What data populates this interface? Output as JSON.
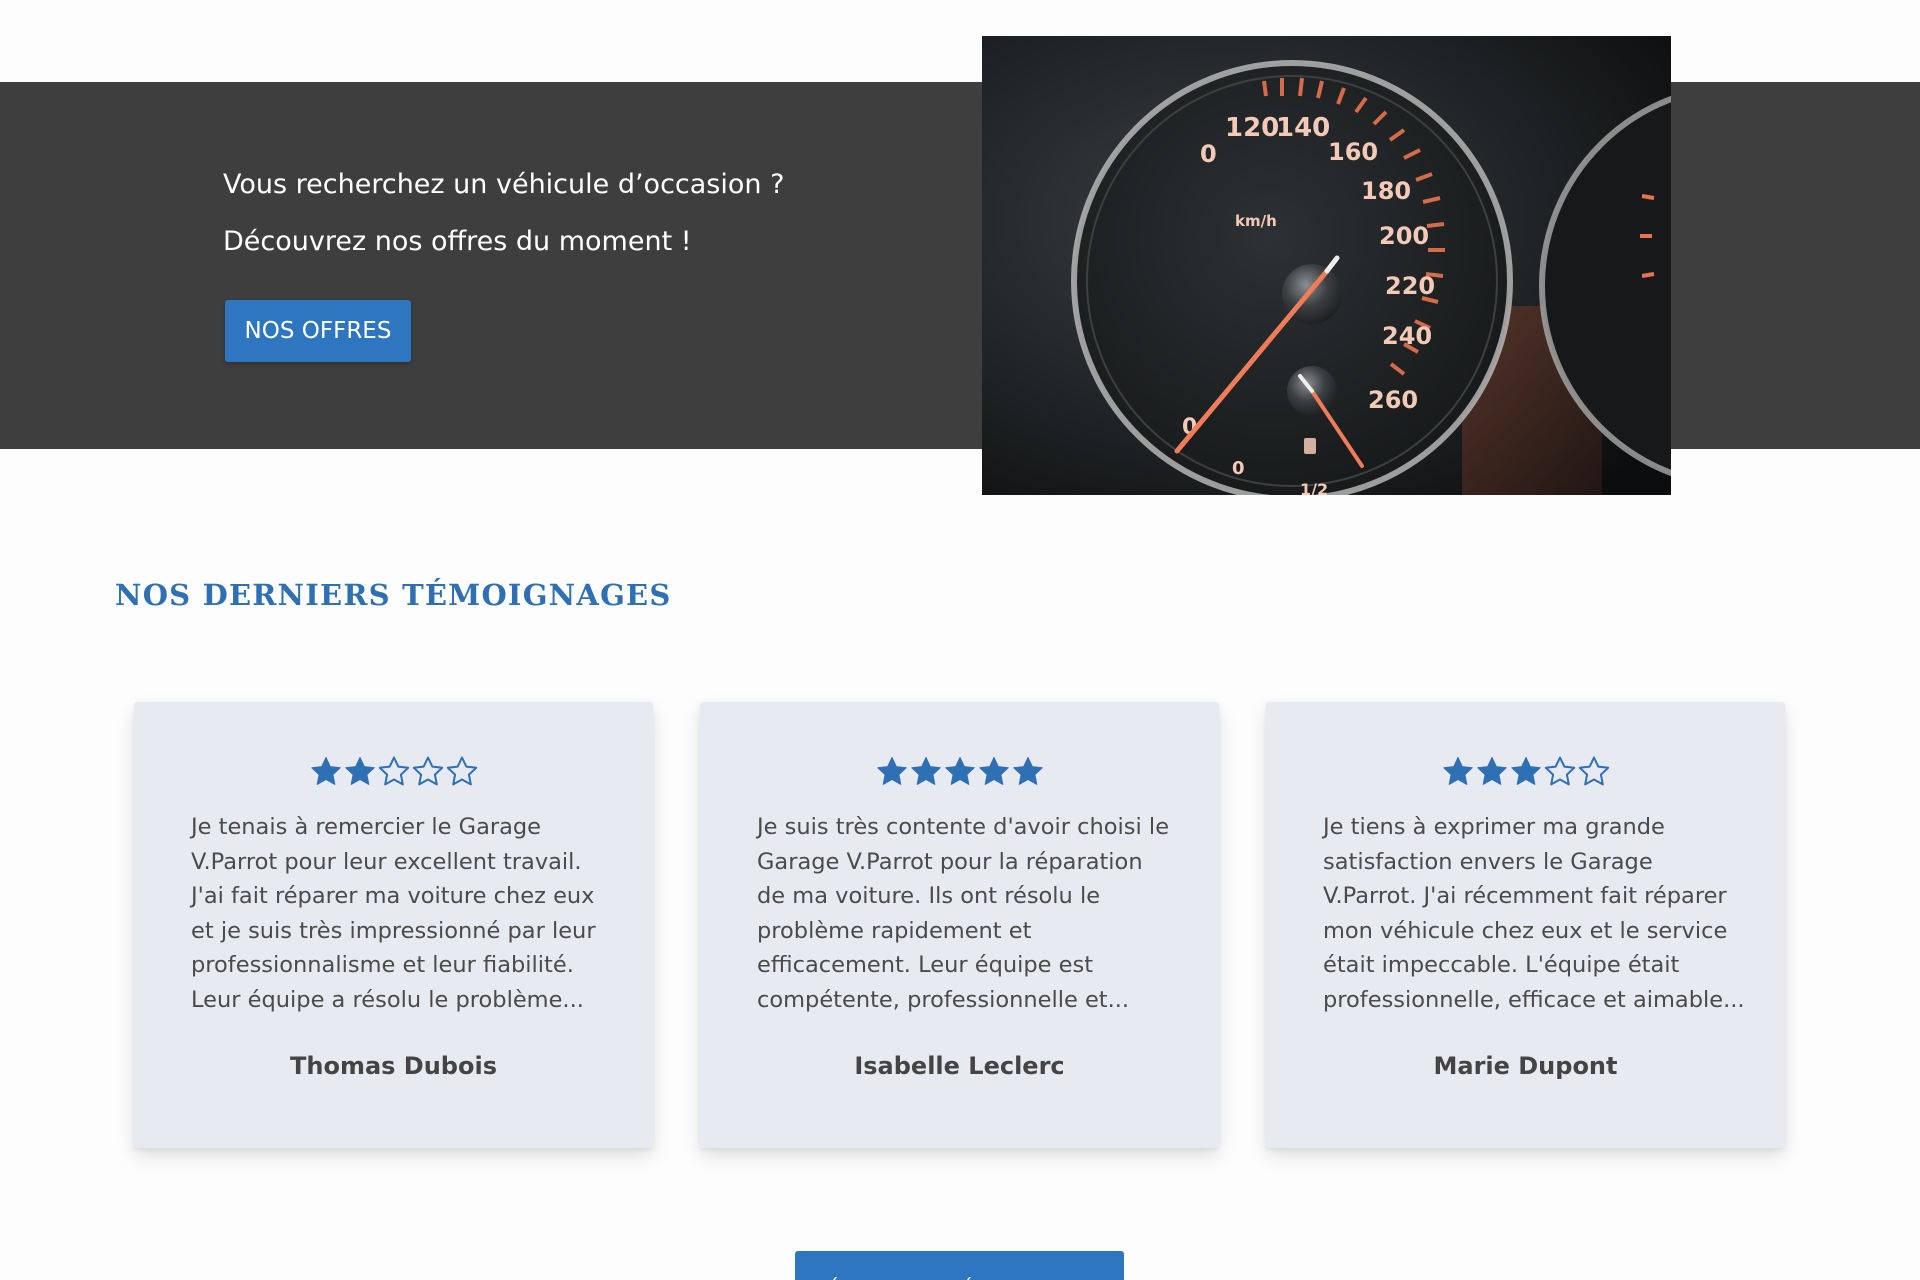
{
  "hero": {
    "line1": "Vous recherchez un véhicule d’occasion ?",
    "line2": "Découvrez nos offres du moment !",
    "button_label": "NOS OFFRES",
    "image_icon": "speedometer-photo",
    "image_texts": [
      "120",
      "140",
      "160",
      "180",
      "200",
      "220",
      "240",
      "260",
      "km/h",
      "0",
      "1/2"
    ]
  },
  "testimonials": {
    "title": "NOS DERNIERS TÉMOIGNAGES",
    "star_color": "#2f6fb3",
    "cards": [
      {
        "rating": 2,
        "max_rating": 5,
        "lines": [
          "Je tenais à remercier le Garage",
          "V.Parrot pour leur excellent travail.",
          "J'ai fait réparer ma voiture chez eux",
          "et je suis très impressionné par leur",
          "professionnalisme et leur fiabilité.",
          "Leur équipe a résolu le problème..."
        ],
        "author": "Thomas Dubois"
      },
      {
        "rating": 5,
        "max_rating": 5,
        "lines": [
          "Je suis très contente d'avoir choisi le",
          "Garage V.Parrot pour la réparation",
          "de ma voiture. Ils ont résolu le",
          "problème rapidement et",
          "efficacement. Leur équipe est",
          "compétente, professionnelle et..."
        ],
        "author": "Isabelle Leclerc"
      },
      {
        "rating": 3,
        "max_rating": 5,
        "lines": [
          "Je tiens à exprimer ma grande",
          "satisfaction envers le Garage",
          "V.Parrot. J'ai récemment fait réparer",
          "mon véhicule chez eux et le service",
          "était impeccable. L'équipe était",
          "professionnelle, efficace et aimable..."
        ],
        "author": "Marie Dupont"
      }
    ],
    "write_button_label": "ÉCRIRE UN TÉMOIGNAGE"
  },
  "colors": {
    "hero_band": "#3e3e3e",
    "accent_blue": "#2f76c0",
    "card_bg": "#e8eaf2"
  }
}
